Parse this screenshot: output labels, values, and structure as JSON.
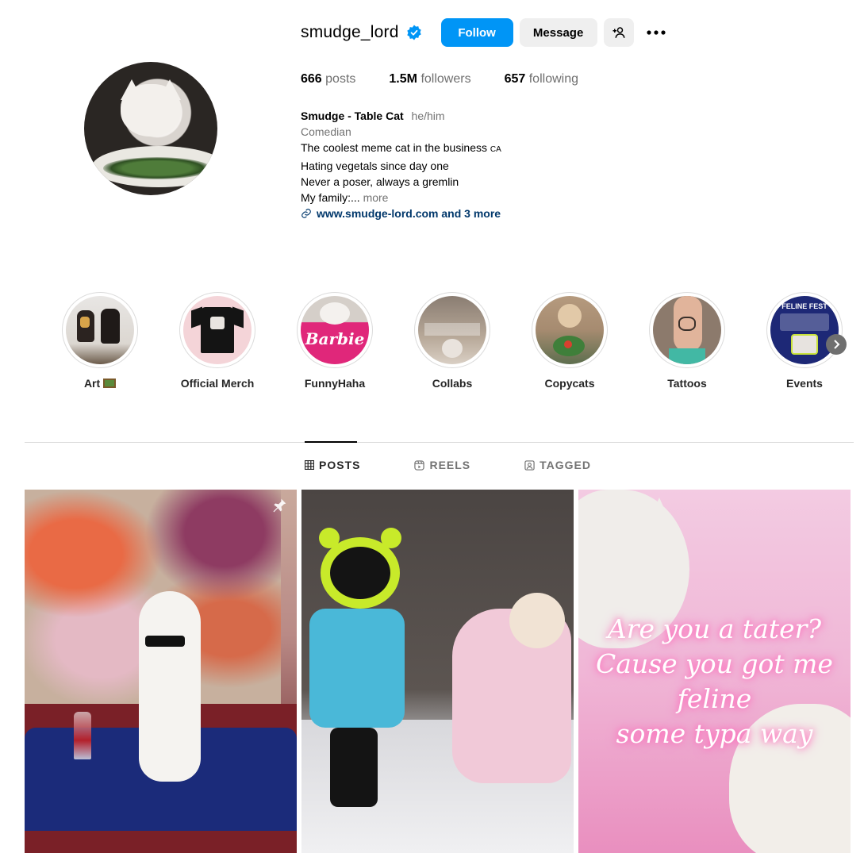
{
  "profile": {
    "username": "smudge_lord",
    "follow_label": "Follow",
    "message_label": "Message",
    "stats": {
      "posts_count": "666",
      "posts_label": "posts",
      "followers_count": "1.5M",
      "followers_label": "followers",
      "following_count": "657",
      "following_label": "following"
    },
    "bio": {
      "display_name": "Smudge - Table Cat",
      "pronouns": "he/him",
      "category": "Comedian",
      "line1": "The coolest meme cat in the business",
      "line1_suffix": "CA",
      "line2": "Hating vegetals since day one",
      "line3": "Never a poser, always a gremlin",
      "line4": "My family:...",
      "more_label": "more",
      "link": "www.smudge-lord.com and 3 more"
    }
  },
  "highlights": [
    {
      "label": "Art",
      "icon": "framed-picture-emoji"
    },
    {
      "label": "Official Merch"
    },
    {
      "label": "FunnyHaha",
      "image_text": "Barbie"
    },
    {
      "label": "Collabs"
    },
    {
      "label": "Copycats"
    },
    {
      "label": "Tattoos"
    },
    {
      "label": "Events",
      "image_text": "FELINE FEST"
    }
  ],
  "tabs": [
    {
      "label": "POSTS",
      "icon": "grid-icon",
      "active": true
    },
    {
      "label": "REELS",
      "icon": "reels-icon",
      "active": false
    },
    {
      "label": "TAGGED",
      "icon": "tagged-icon",
      "active": false
    }
  ],
  "posts": [
    {
      "pinned": true
    },
    {},
    {
      "overlay_text": [
        "Are you a tater?",
        "Cause you got me feline",
        "some typa way"
      ]
    }
  ],
  "colors": {
    "follow_button": "#0095f6",
    "secondary_button": "#efefef",
    "link": "#00376b",
    "muted_text": "#737373",
    "verified_badge": "#0095f6"
  }
}
